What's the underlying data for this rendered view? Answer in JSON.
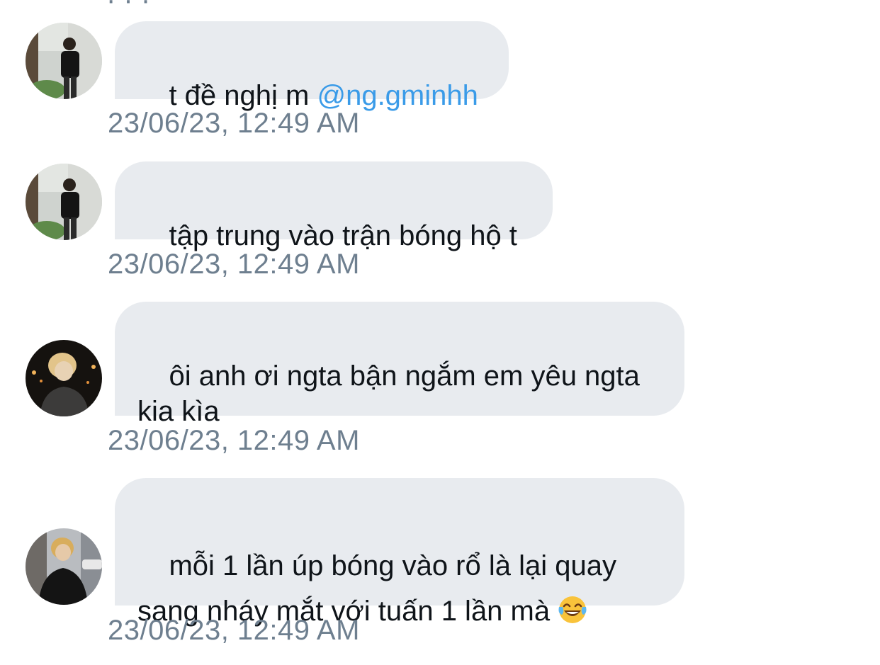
{
  "messages": [
    {
      "avatar": "avatar-boy-street",
      "text": "t đề nghị m ",
      "mention": "@ng.gminhh",
      "timestamp": "23/06/23, 12:49 AM"
    },
    {
      "avatar": "avatar-boy-street",
      "text": "tập trung vào trận bóng hộ t",
      "timestamp": "23/06/23, 12:49 AM"
    },
    {
      "avatar": "avatar-blond-night",
      "text": "ôi anh ơi ngta bận ngắm em yêu ngta\nkia kìa",
      "timestamp": "23/06/23, 12:49 AM"
    },
    {
      "avatar": "avatar-blond-street",
      "text": "mỗi 1 lần úp bóng vào rổ là lại quay\nsang nháy mắt với tuấn 1 lần mà ",
      "emoji": "face-with-tears-of-joy-icon",
      "timestamp": "23/06/23, 12:49 AM"
    }
  ],
  "colors": {
    "bubble": "#e8ebef",
    "text": "#0f1419",
    "mention": "#3a9be8",
    "timestamp": "#6e7f8f"
  }
}
